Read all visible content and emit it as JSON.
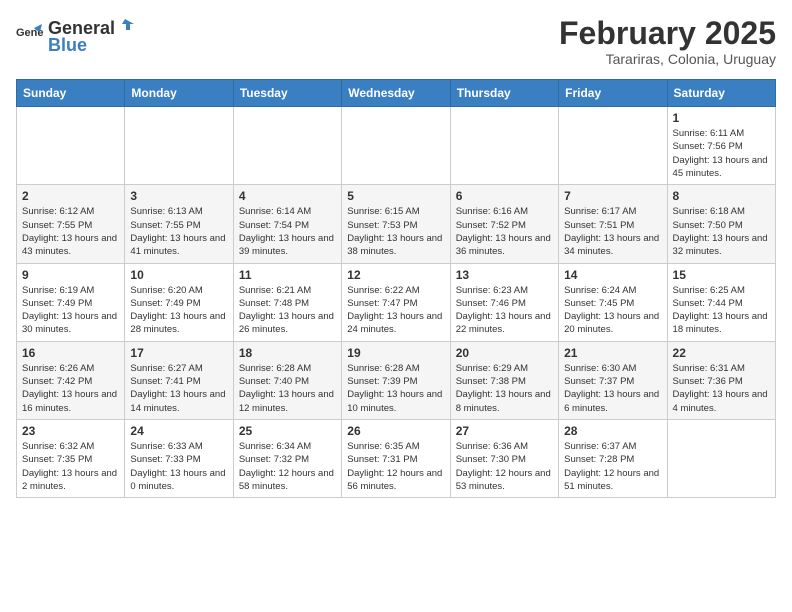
{
  "header": {
    "logo_general": "General",
    "logo_blue": "Blue",
    "month_title": "February 2025",
    "subtitle": "Tarariras, Colonia, Uruguay"
  },
  "weekdays": [
    "Sunday",
    "Monday",
    "Tuesday",
    "Wednesday",
    "Thursday",
    "Friday",
    "Saturday"
  ],
  "weeks": [
    [
      null,
      null,
      null,
      null,
      null,
      null,
      {
        "day": "1",
        "sunrise": "6:11 AM",
        "sunset": "7:56 PM",
        "daylight": "13 hours and 45 minutes."
      }
    ],
    [
      {
        "day": "2",
        "sunrise": "6:12 AM",
        "sunset": "7:55 PM",
        "daylight": "13 hours and 43 minutes."
      },
      {
        "day": "3",
        "sunrise": "6:13 AM",
        "sunset": "7:55 PM",
        "daylight": "13 hours and 41 minutes."
      },
      {
        "day": "4",
        "sunrise": "6:14 AM",
        "sunset": "7:54 PM",
        "daylight": "13 hours and 39 minutes."
      },
      {
        "day": "5",
        "sunrise": "6:15 AM",
        "sunset": "7:53 PM",
        "daylight": "13 hours and 38 minutes."
      },
      {
        "day": "6",
        "sunrise": "6:16 AM",
        "sunset": "7:52 PM",
        "daylight": "13 hours and 36 minutes."
      },
      {
        "day": "7",
        "sunrise": "6:17 AM",
        "sunset": "7:51 PM",
        "daylight": "13 hours and 34 minutes."
      },
      {
        "day": "8",
        "sunrise": "6:18 AM",
        "sunset": "7:50 PM",
        "daylight": "13 hours and 32 minutes."
      }
    ],
    [
      {
        "day": "9",
        "sunrise": "6:19 AM",
        "sunset": "7:49 PM",
        "daylight": "13 hours and 30 minutes."
      },
      {
        "day": "10",
        "sunrise": "6:20 AM",
        "sunset": "7:49 PM",
        "daylight": "13 hours and 28 minutes."
      },
      {
        "day": "11",
        "sunrise": "6:21 AM",
        "sunset": "7:48 PM",
        "daylight": "13 hours and 26 minutes."
      },
      {
        "day": "12",
        "sunrise": "6:22 AM",
        "sunset": "7:47 PM",
        "daylight": "13 hours and 24 minutes."
      },
      {
        "day": "13",
        "sunrise": "6:23 AM",
        "sunset": "7:46 PM",
        "daylight": "13 hours and 22 minutes."
      },
      {
        "day": "14",
        "sunrise": "6:24 AM",
        "sunset": "7:45 PM",
        "daylight": "13 hours and 20 minutes."
      },
      {
        "day": "15",
        "sunrise": "6:25 AM",
        "sunset": "7:44 PM",
        "daylight": "13 hours and 18 minutes."
      }
    ],
    [
      {
        "day": "16",
        "sunrise": "6:26 AM",
        "sunset": "7:42 PM",
        "daylight": "13 hours and 16 minutes."
      },
      {
        "day": "17",
        "sunrise": "6:27 AM",
        "sunset": "7:41 PM",
        "daylight": "13 hours and 14 minutes."
      },
      {
        "day": "18",
        "sunrise": "6:28 AM",
        "sunset": "7:40 PM",
        "daylight": "13 hours and 12 minutes."
      },
      {
        "day": "19",
        "sunrise": "6:28 AM",
        "sunset": "7:39 PM",
        "daylight": "13 hours and 10 minutes."
      },
      {
        "day": "20",
        "sunrise": "6:29 AM",
        "sunset": "7:38 PM",
        "daylight": "13 hours and 8 minutes."
      },
      {
        "day": "21",
        "sunrise": "6:30 AM",
        "sunset": "7:37 PM",
        "daylight": "13 hours and 6 minutes."
      },
      {
        "day": "22",
        "sunrise": "6:31 AM",
        "sunset": "7:36 PM",
        "daylight": "13 hours and 4 minutes."
      }
    ],
    [
      {
        "day": "23",
        "sunrise": "6:32 AM",
        "sunset": "7:35 PM",
        "daylight": "13 hours and 2 minutes."
      },
      {
        "day": "24",
        "sunrise": "6:33 AM",
        "sunset": "7:33 PM",
        "daylight": "13 hours and 0 minutes."
      },
      {
        "day": "25",
        "sunrise": "6:34 AM",
        "sunset": "7:32 PM",
        "daylight": "12 hours and 58 minutes."
      },
      {
        "day": "26",
        "sunrise": "6:35 AM",
        "sunset": "7:31 PM",
        "daylight": "12 hours and 56 minutes."
      },
      {
        "day": "27",
        "sunrise": "6:36 AM",
        "sunset": "7:30 PM",
        "daylight": "12 hours and 53 minutes."
      },
      {
        "day": "28",
        "sunrise": "6:37 AM",
        "sunset": "7:28 PM",
        "daylight": "12 hours and 51 minutes."
      },
      null
    ]
  ]
}
